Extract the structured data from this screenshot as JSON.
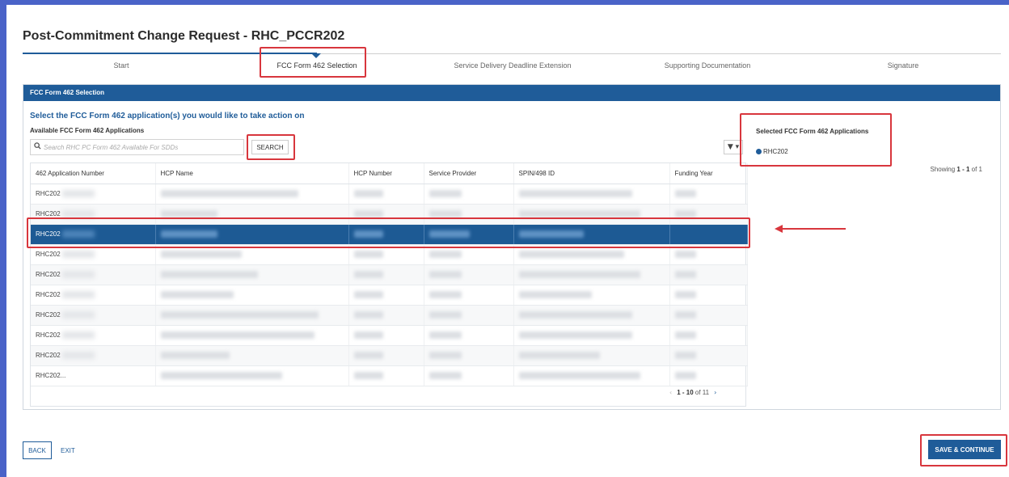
{
  "page_title": "Post-Commitment Change Request - RHC_PCCR202",
  "stepper": {
    "steps": [
      {
        "label": "Start"
      },
      {
        "label": "FCC Form 462 Selection"
      },
      {
        "label": "Service Delivery Deadline Extension"
      },
      {
        "label": "Supporting Documentation"
      },
      {
        "label": "Signature"
      }
    ],
    "active_step": "FCC Form 462 Selection"
  },
  "panel": {
    "header": "FCC Form 462 Selection",
    "instruction": "Select the FCC Form 462 application(s) you would like to take action on",
    "available_label": "Available FCC Form 462 Applications",
    "search": {
      "placeholder": "Search RHC PC Form 462 Available For SDDs",
      "value": "",
      "button_label": "SEARCH",
      "icon": "search-icon"
    },
    "filter_label": "▼ ▾",
    "selected_label": "Selected FCC Form 462 Applications",
    "selected_items": [
      "RHC202"
    ],
    "showing": {
      "prefix": "Showing ",
      "range": "1 - 1",
      "suffix": " of 1"
    }
  },
  "table": {
    "columns": [
      "462 Application Number",
      "HCP Name",
      "HCP Number",
      "Service Provider",
      "SPIN/498 ID",
      "Funding Year"
    ],
    "rows": [
      {
        "app_number": "RHC202",
        "selected": false
      },
      {
        "app_number": "RHC202",
        "selected": false
      },
      {
        "app_number": "RHC202",
        "selected": true
      },
      {
        "app_number": "RHC202",
        "selected": false
      },
      {
        "app_number": "RHC202",
        "selected": false
      },
      {
        "app_number": "RHC202",
        "selected": false
      },
      {
        "app_number": "RHC202",
        "selected": false
      },
      {
        "app_number": "RHC202",
        "selected": false
      },
      {
        "app_number": "RHC202",
        "selected": false
      },
      {
        "app_number": "RHC202...",
        "selected": false
      }
    ],
    "pagination": {
      "range": "1 - 10",
      "suffix": " of 11",
      "prev": "‹",
      "next": "›"
    }
  },
  "footer": {
    "back_label": "BACK",
    "exit_label": "EXIT",
    "save_label": "SAVE & CONTINUE"
  },
  "colors": {
    "primary": "#1f5c99",
    "highlight_border": "#d8363d",
    "frame": "#4a63c8"
  }
}
